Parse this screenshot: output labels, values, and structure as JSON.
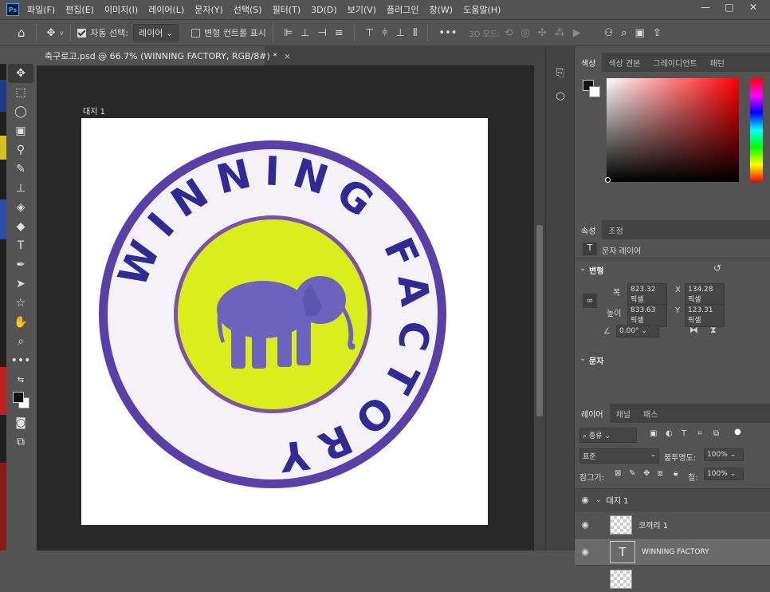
{
  "menu": [
    "파일(F)",
    "편집(E)",
    "이미지(I)",
    "레이어(L)",
    "문자(Y)",
    "선택(S)",
    "필터(T)",
    "3D(D)",
    "보기(V)",
    "플러그인",
    "창(W)",
    "도움말(H)"
  ],
  "app_logo": "Ps",
  "options": {
    "auto_select_label": "자동 선택:",
    "auto_select_value": "레이어",
    "transform_controls_label": "변형 컨트롤 표시",
    "mode_3d_label": "3D 모드:",
    "more": "•••"
  },
  "document_tab": {
    "title": "축구로고.psd @ 66.7% (WINNING FACTORY, RGB/8#) *",
    "close": "×"
  },
  "artboard_label": "대지 1",
  "logo": {
    "ring_text": "WINNING FACTORY",
    "colors": {
      "outer_ring": "#5a3fa8",
      "inner_fill": "#d9ee1c",
      "inner_ring": "#7b52a6",
      "elephant": "#6d63bf",
      "band": "#f4f2f6",
      "text": "#2f2a94"
    }
  },
  "color_panel": {
    "tabs": [
      "색상",
      "색상 견본",
      "그레이디언트",
      "패턴"
    ],
    "hue": "#ff0000"
  },
  "properties_panel": {
    "tabs": [
      "속성",
      "조정"
    ],
    "layer_kind": "문자 레이어",
    "transform_header": "변형",
    "width_label": "폭",
    "width_value": "823.32 픽셀",
    "x_label": "X",
    "x_value": "134.28 픽셀",
    "height_label": "높이",
    "height_value": "833.63 픽셀",
    "y_label": "Y",
    "y_value": "123.31 픽셀",
    "angle_value": "0.00°",
    "text_header": "문자"
  },
  "layers_panel": {
    "tabs": [
      "레이어",
      "채널",
      "패스"
    ],
    "filter_label": "종류",
    "blend_mode": "표준",
    "opacity_label": "불투명도:",
    "opacity_value": "100%",
    "lock_label": "잠그기:",
    "fill_label": "칠:",
    "fill_value": "100%",
    "layers": [
      {
        "name": "대지 1",
        "type": "artboard"
      },
      {
        "name": "코끼리 1",
        "type": "image"
      },
      {
        "name": "WINNING FACTORY",
        "type": "text"
      }
    ]
  }
}
